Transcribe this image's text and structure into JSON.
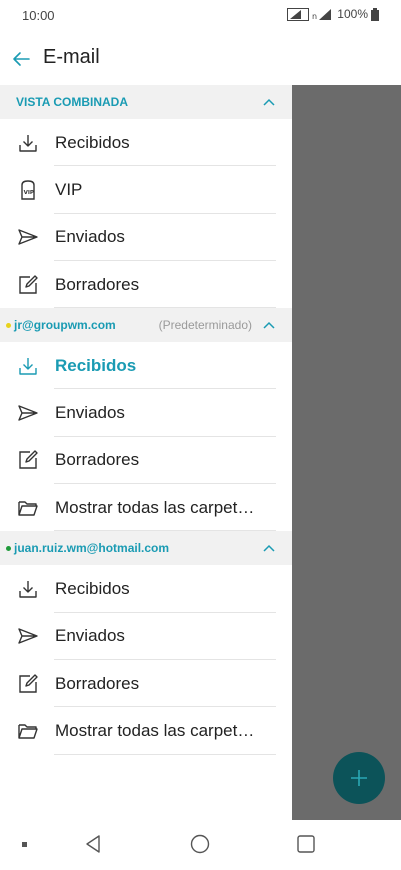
{
  "status_bar": {
    "time": "10:00",
    "battery": "100%"
  },
  "header": {
    "title": "E-mail"
  },
  "colors": {
    "accent": "#1a9bb3",
    "overlay": "#6b6b6b",
    "fab": "#0c5359",
    "dot_yellow": "#e8d21a",
    "dot_green": "#1f9a3a"
  },
  "sections": [
    {
      "title": "VISTA COMBINADA",
      "items": [
        {
          "icon": "inbox-icon",
          "label": "Recibidos"
        },
        {
          "icon": "vip-icon",
          "label": "VIP"
        },
        {
          "icon": "sent-icon",
          "label": "Enviados"
        },
        {
          "icon": "drafts-icon",
          "label": "Borradores"
        }
      ]
    },
    {
      "title": "jr@groupwm.com",
      "subtitle": "(Predeterminado)",
      "items": [
        {
          "icon": "inbox-icon",
          "label": "Recibidos"
        },
        {
          "icon": "sent-icon",
          "label": "Enviados"
        },
        {
          "icon": "drafts-icon",
          "label": "Borradores"
        },
        {
          "icon": "folder-icon",
          "label": "Mostrar todas las carpet…"
        }
      ]
    },
    {
      "title": "juan.ruiz.wm@hotmail.com",
      "items": [
        {
          "icon": "inbox-icon",
          "label": "Recibidos"
        },
        {
          "icon": "sent-icon",
          "label": "Enviados"
        },
        {
          "icon": "drafts-icon",
          "label": "Borradores"
        },
        {
          "icon": "folder-icon",
          "label": "Mostrar todas las carpet…"
        }
      ]
    }
  ],
  "fab": {
    "icon": "plus-icon"
  }
}
